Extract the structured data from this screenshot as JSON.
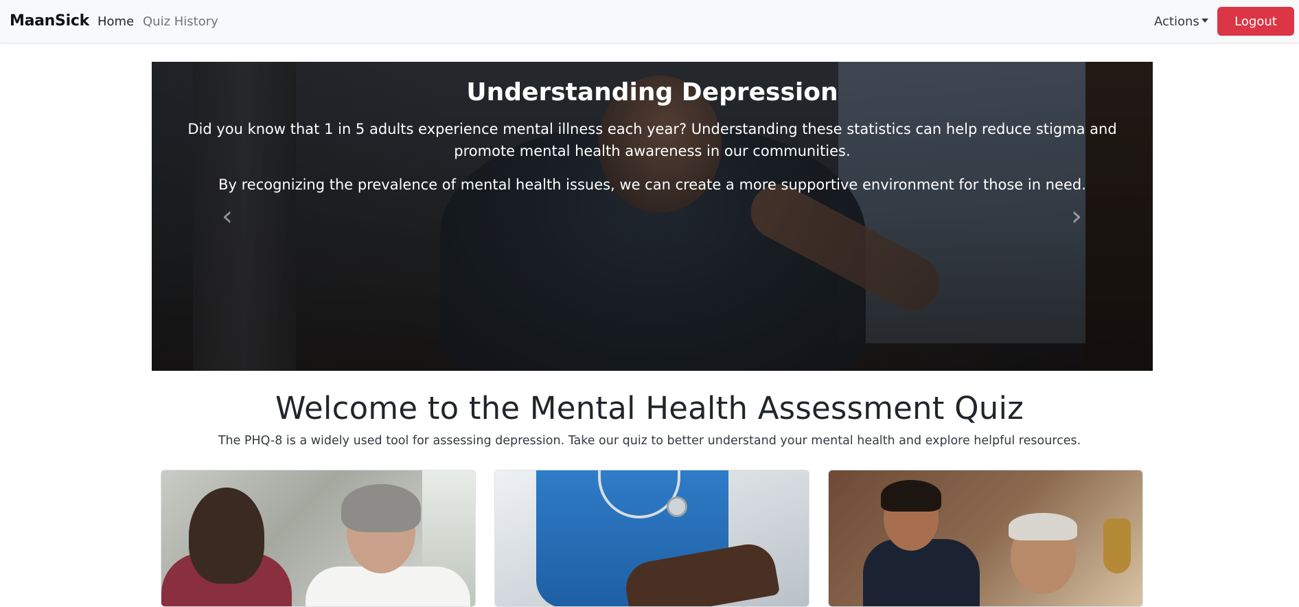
{
  "navbar": {
    "brand": "MaanSick",
    "links": [
      {
        "label": "Home",
        "active": true
      },
      {
        "label": "Quiz History",
        "active": false
      }
    ],
    "actions_label": "Actions",
    "logout_label": "Logout",
    "logout_color": "#dc3545"
  },
  "carousel": {
    "title": "Understanding Depression",
    "paragraph1": "Did you know that 1 in 5 adults experience mental illness each year? Understanding these statistics can help reduce stigma and promote mental health awareness in our communities.",
    "paragraph2": "By recognizing the prevalence of mental health issues, we can create a more supportive environment for those in need.",
    "prev_icon": "chevron-left-icon",
    "next_icon": "chevron-right-icon"
  },
  "welcome": {
    "title": "Welcome to the Mental Health Assessment Quiz",
    "subtitle": "The PHQ-8 is a widely used tool for assessing depression. Take our quiz to better understand your mental health and explore helpful resources."
  }
}
